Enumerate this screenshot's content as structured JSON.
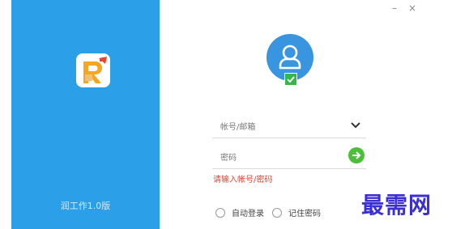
{
  "window": {
    "minimize_label": "–",
    "close_label": "×"
  },
  "left_panel": {
    "version_text": "润工作1.0版",
    "logo_icon": "app-logo-r-icon",
    "background_color": "#2b9fe8"
  },
  "avatar": {
    "icon": "user-icon",
    "status_icon": "check-icon",
    "color": "#3a95e0"
  },
  "login": {
    "account_placeholder": "帐号/邮箱",
    "account_value": "",
    "password_placeholder": "密码",
    "password_value": "",
    "dropdown_icon": "chevron-down-icon",
    "submit_icon": "arrow-right-icon",
    "error_text": "请输入帐号/密码",
    "auto_login_label": "自动登录",
    "remember_password_label": "记住密码"
  },
  "watermark": {
    "text": "最需网"
  },
  "colors": {
    "accent": "#2b9fe8",
    "submit": "#4ac038",
    "error": "#e2442f"
  }
}
